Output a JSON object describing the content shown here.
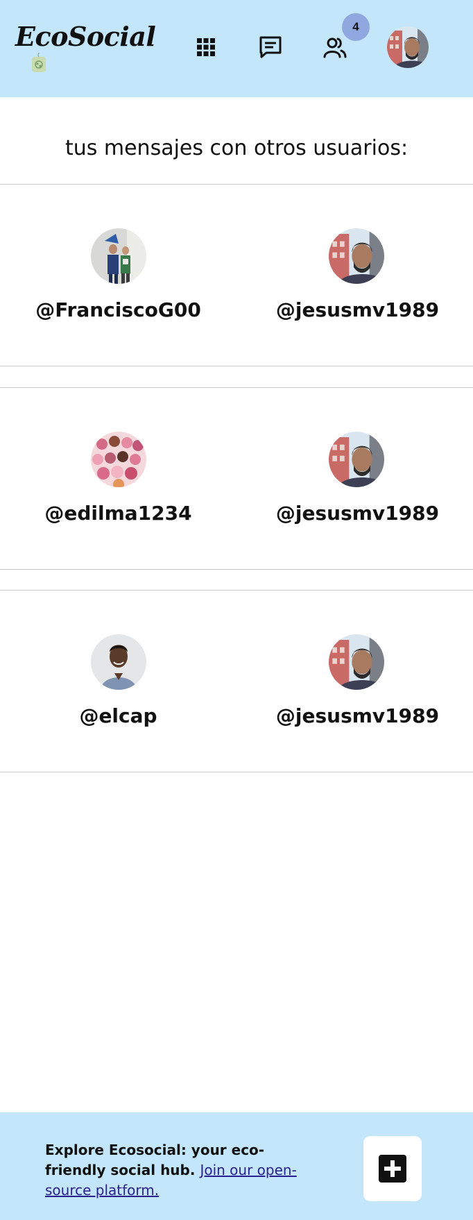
{
  "header": {
    "brand": "EcoSocial",
    "notification_count": "4",
    "icons": {
      "apps": "grid-icon",
      "messages": "chat-icon",
      "friends": "friends-icon"
    },
    "colors": {
      "background": "#c3e6fa",
      "badge": "#8fa8e0"
    }
  },
  "page": {
    "title": "tus mensajes con otros usuarios:"
  },
  "conversations": [
    {
      "left": "@FranciscoG00",
      "right": "@jesusmv1989"
    },
    {
      "left": "@edilma1234",
      "right": "@jesusmv1989"
    },
    {
      "left": "@elcap",
      "right": "@jesusmv1989"
    }
  ],
  "footer": {
    "text": "Explore Ecosocial: your eco-friendly social hub.",
    "link": "Join our open-source platform.",
    "add_icon": "plus-icon"
  }
}
